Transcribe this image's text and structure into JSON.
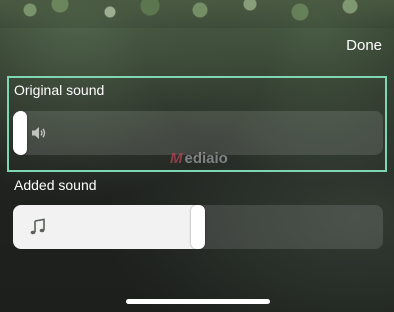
{
  "header": {
    "done_label": "Done"
  },
  "original_sound": {
    "label": "Original sound",
    "icon": "speaker-icon",
    "level": 0.0
  },
  "added_sound": {
    "label": "Added sound",
    "icon": "music-note-icon",
    "level": 0.5
  },
  "watermark": {
    "mark": "M",
    "text": "ediaio"
  },
  "colors": {
    "highlight_border": "#7fd6b3",
    "slider_fill": "#f2f2f2",
    "background": "#1f231f"
  }
}
